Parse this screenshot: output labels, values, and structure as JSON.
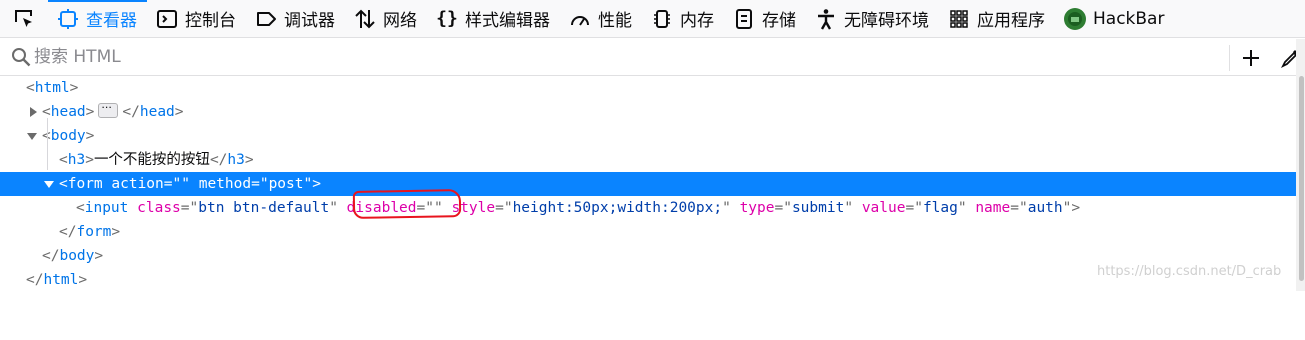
{
  "toolbar": {
    "picker_label": "",
    "tabs": [
      {
        "label": "查看器",
        "icon": "inspector-icon",
        "active": true
      },
      {
        "label": "控制台",
        "icon": "console-icon"
      },
      {
        "label": "调试器",
        "icon": "debugger-icon"
      },
      {
        "label": "网络",
        "icon": "network-icon"
      },
      {
        "label": "样式编辑器",
        "icon": "style-editor-icon"
      },
      {
        "label": "性能",
        "icon": "performance-icon"
      },
      {
        "label": "内存",
        "icon": "memory-icon"
      },
      {
        "label": "存储",
        "icon": "storage-icon"
      },
      {
        "label": "无障碍环境",
        "icon": "accessibility-icon"
      },
      {
        "label": "应用程序",
        "icon": "application-icon"
      },
      {
        "label": "HackBar",
        "icon": "hackbar-icon"
      }
    ],
    "accent_color": "#0a84ff"
  },
  "search": {
    "placeholder": "搜索 HTML",
    "value": ""
  },
  "markup": {
    "html_open": "html",
    "head": "head",
    "body_open": "body",
    "h3_tag": "h3",
    "h3_text": "一个不能按的按钮",
    "form_tag": "form",
    "form_attrs": [
      {
        "name": "action",
        "value": ""
      },
      {
        "name": "method",
        "value": "post"
      }
    ],
    "input_tag": "input",
    "input_attrs": [
      {
        "name": "class",
        "value": "btn btn-default"
      },
      {
        "name": "disabled",
        "value": ""
      },
      {
        "name": "style",
        "value": "height:50px;width:200px;"
      },
      {
        "name": "type",
        "value": "submit"
      },
      {
        "name": "value",
        "value": "flag"
      },
      {
        "name": "name",
        "value": "auth"
      }
    ],
    "selected_line": "form"
  },
  "annotation": {
    "color": "#e8141e",
    "target": "disabled=\"\""
  },
  "watermark": "https://blog.csdn.net/D_crab"
}
